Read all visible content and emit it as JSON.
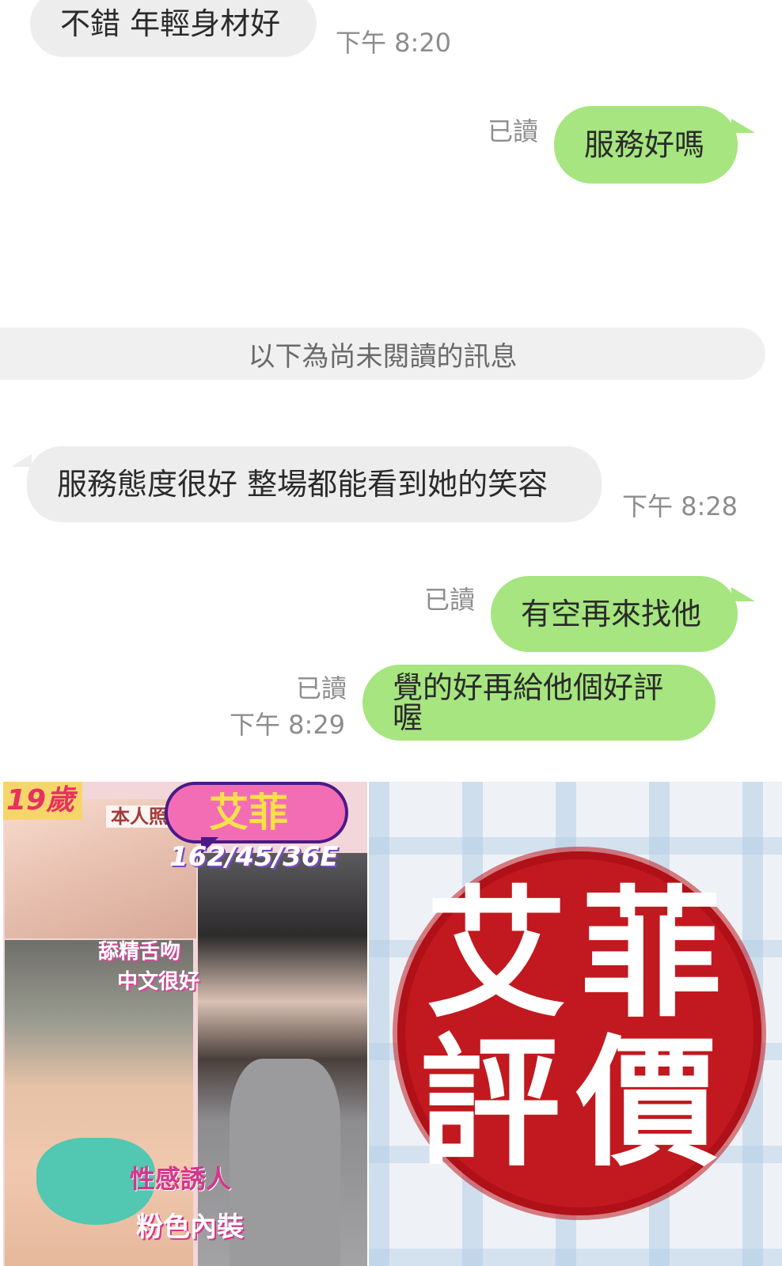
{
  "messages": [
    {
      "id": "m1",
      "side": "in",
      "text": "不錯 年輕身材好",
      "time": "下午 8:20"
    },
    {
      "id": "m2",
      "side": "out",
      "text": "服務好嗎",
      "read": "已讀"
    },
    {
      "id": "m3",
      "side": "in",
      "text": "服務態度很好 整場都能看到她的笑容",
      "time": "下午 8:28"
    },
    {
      "id": "m4",
      "side": "out",
      "text": "有空再來找他",
      "read": "已讀"
    },
    {
      "id": "m5",
      "side": "out",
      "text": "覺的好再給他個好評喔",
      "read": "已讀",
      "time": "下午 8:29"
    }
  ],
  "unread_divider": "以下為尚未閱讀的訊息",
  "promo": {
    "age_tag": "19歲",
    "photo_tag": "本人照",
    "name": "艾菲",
    "stats": "162/45/36E",
    "tag_1": "舔精舌吻",
    "tag_2": "中文很好",
    "tag_3": "性感誘人",
    "tag_4": "粉色內裝"
  },
  "stamp": {
    "line1": [
      "艾",
      "菲"
    ],
    "line2": [
      "評",
      "價"
    ]
  },
  "colors": {
    "incoming": "#ededed",
    "outgoing": "#a6e57f",
    "meta": "#8d8d8d",
    "stamp_red": "#c1191f"
  }
}
